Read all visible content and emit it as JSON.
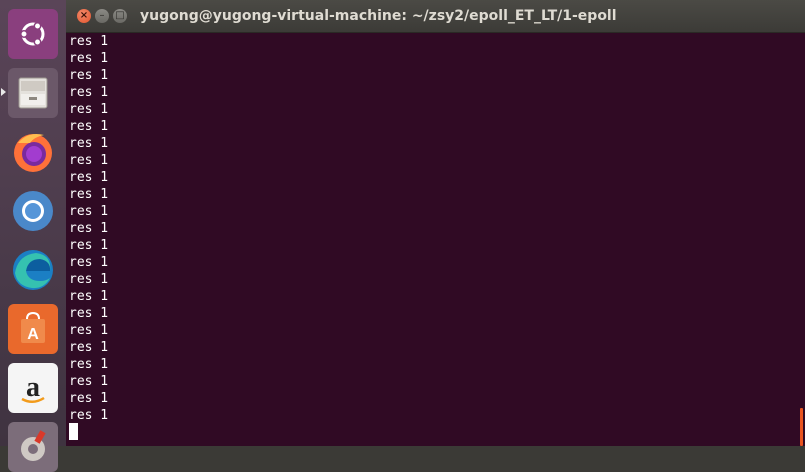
{
  "launcher": {
    "items": [
      {
        "name": "ubuntu-dash-icon"
      },
      {
        "name": "files-icon"
      },
      {
        "name": "firefox-icon"
      },
      {
        "name": "chromium-icon"
      },
      {
        "name": "edge-icon"
      },
      {
        "name": "software-center-icon"
      },
      {
        "name": "amazon-icon"
      },
      {
        "name": "settings-icon"
      }
    ]
  },
  "window": {
    "title": "yugong@yugong-virtual-machine: ~/zsy2/epoll_ET_LT/1-epoll",
    "close_glyph": "×",
    "minimize_glyph": "–",
    "maximize_glyph": "□"
  },
  "terminal": {
    "lines": [
      "res 1",
      "res 1",
      "res 1",
      "res 1",
      "res 1",
      "res 1",
      "res 1",
      "res 1",
      "res 1",
      "res 1",
      "res 1",
      "res 1",
      "res 1",
      "res 1",
      "res 1",
      "res 1",
      "res 1",
      "res 1",
      "res 1",
      "res 1",
      "res 1",
      "res 1",
      "res 1"
    ]
  },
  "colors": {
    "terminal_bg": "#300a24",
    "terminal_fg": "#ffffff",
    "accent": "#e95420"
  }
}
